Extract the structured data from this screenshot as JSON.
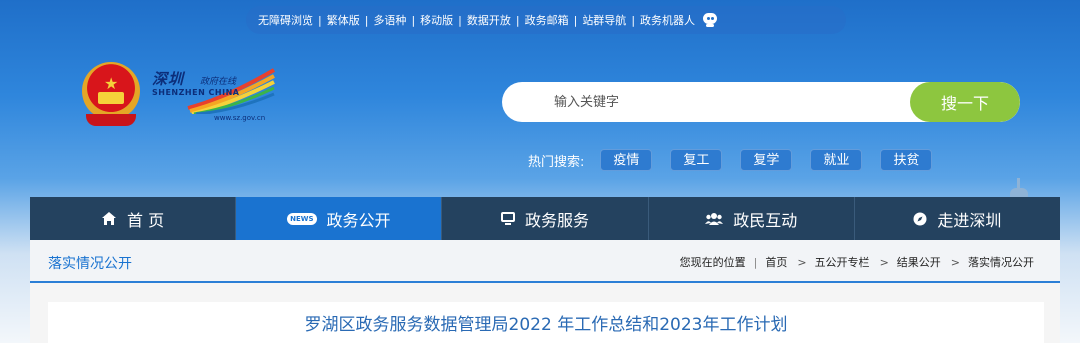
{
  "topbar": {
    "links": [
      "无障碍浏览",
      "繁体版",
      "多语种",
      "移动版",
      "数据开放",
      "政务邮箱",
      "站群导航",
      "政务机器人"
    ]
  },
  "logo": {
    "cn_title": "深圳",
    "cn_sub": "政府在线",
    "en_title": "SHENZHEN CHINA",
    "url": "www.sz.gov.cn"
  },
  "search": {
    "placeholder": "输入关键字",
    "button_label": "搜一下"
  },
  "hot_search": {
    "label": "热门搜索:",
    "tags": [
      "疫情",
      "复工",
      "复学",
      "就业",
      "扶贫"
    ]
  },
  "nav": {
    "items": [
      {
        "label": "首 页",
        "icon": "home-icon"
      },
      {
        "label": "政务公开",
        "icon": "news-icon"
      },
      {
        "label": "政务服务",
        "icon": "monitor-icon"
      },
      {
        "label": "政民互动",
        "icon": "people-icon"
      },
      {
        "label": "走进深圳",
        "icon": "compass-icon"
      }
    ],
    "active_index": 1
  },
  "section": {
    "title": "落实情况公开",
    "breadcrumb": {
      "prefix": "您现在的位置",
      "items": [
        "首页",
        "五公开专栏",
        "结果公开",
        "落实情况公开"
      ]
    }
  },
  "article": {
    "title": "罗湖区政务服务数据管理局2022 年工作总结和2023年工作计划"
  },
  "colors": {
    "nav_bg": "#24425f",
    "nav_active": "#1a73d0",
    "search_button": "#8dc63f",
    "accent": "#2c7fd6"
  }
}
